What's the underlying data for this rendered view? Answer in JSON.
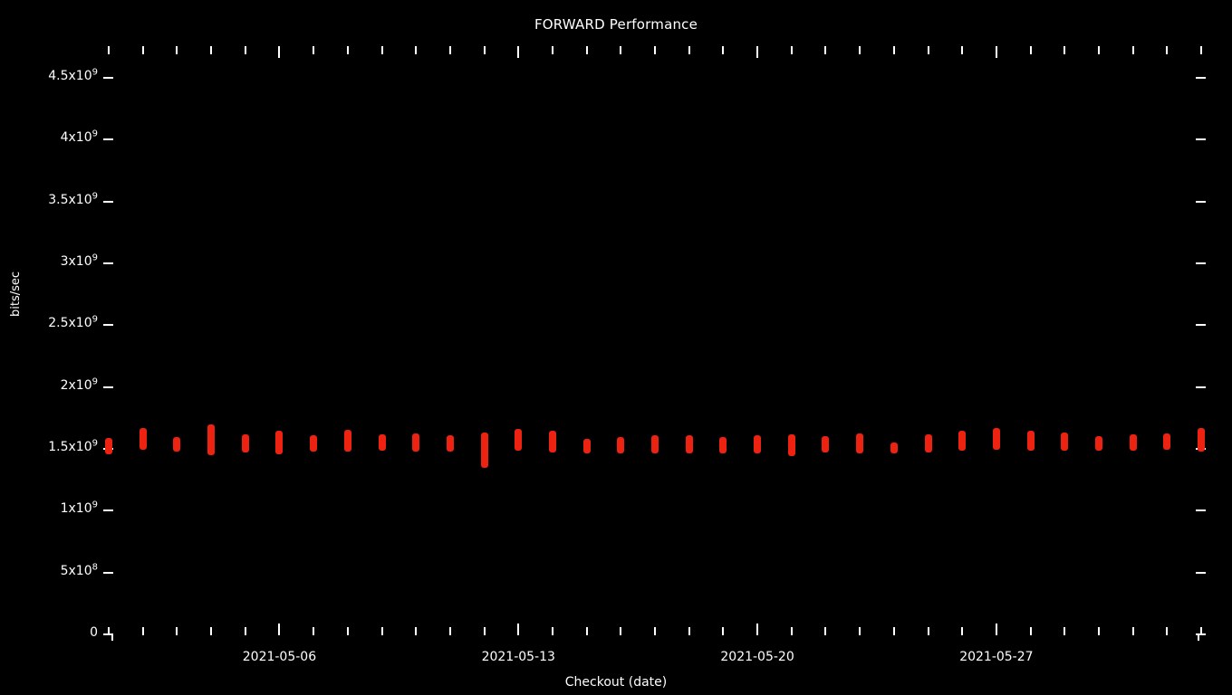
{
  "chart_data": {
    "type": "scatter",
    "title": "FORWARD Performance",
    "xlabel": "Checkout (date)",
    "ylabel": "bits/sec",
    "grid": false,
    "legend": null,
    "point_color": "#ee2211",
    "background": "#000000",
    "foreground": "#ffffff",
    "ylim": [
      0,
      4750000000
    ],
    "y_ticks": [
      {
        "value": 0,
        "label": "0"
      },
      {
        "value": 500000000,
        "label": "5x10",
        "exp": "8"
      },
      {
        "value": 1000000000,
        "label": "1x10",
        "exp": "9"
      },
      {
        "value": 1500000000,
        "label": "1.5x10",
        "exp": "9"
      },
      {
        "value": 2000000000,
        "label": "2x10",
        "exp": "9"
      },
      {
        "value": 2500000000,
        "label": "2.5x10",
        "exp": "9"
      },
      {
        "value": 3000000000,
        "label": "3x10",
        "exp": "9"
      },
      {
        "value": 3500000000,
        "label": "3.5x10",
        "exp": "9"
      },
      {
        "value": 4000000000,
        "label": "4x10",
        "exp": "9"
      },
      {
        "value": 4500000000,
        "label": "4.5x10",
        "exp": "9"
      }
    ],
    "x_tick_labels": [
      {
        "label": "2021-05-06",
        "index": 5
      },
      {
        "label": "2021-05-13",
        "index": 12
      },
      {
        "label": "2021-05-20",
        "index": 19
      },
      {
        "label": "2021-05-27",
        "index": 26
      }
    ],
    "x_major_indices": [
      5,
      12,
      19,
      26
    ],
    "x_tick_count": 33,
    "x": [
      "2021-05-01",
      "2021-05-02",
      "2021-05-03",
      "2021-05-04",
      "2021-05-05",
      "2021-05-06",
      "2021-05-07",
      "2021-05-08",
      "2021-05-09",
      "2021-05-10",
      "2021-05-11",
      "2021-05-12",
      "2021-05-13",
      "2021-05-14",
      "2021-05-15",
      "2021-05-16",
      "2021-05-17",
      "2021-05-18",
      "2021-05-19",
      "2021-05-20",
      "2021-05-21",
      "2021-05-22",
      "2021-05-23",
      "2021-05-24",
      "2021-05-25",
      "2021-05-26",
      "2021-05-27",
      "2021-05-28",
      "2021-05-29",
      "2021-05-30",
      "2021-05-31",
      "2021-06-01",
      "2021-06-02"
    ],
    "values": [
      1520000000,
      1580000000,
      1540000000,
      1570000000,
      1545000000,
      1555000000,
      1545000000,
      1565000000,
      1550000000,
      1550000000,
      1545000000,
      1500000000,
      1570000000,
      1560000000,
      1520000000,
      1530000000,
      1540000000,
      1540000000,
      1530000000,
      1540000000,
      1530000000,
      1535000000,
      1545000000,
      1510000000,
      1545000000,
      1565000000,
      1580000000,
      1565000000,
      1560000000,
      1545000000,
      1555000000,
      1560000000,
      1570000000
    ],
    "spread": [
      18,
      24,
      16,
      34,
      20,
      26,
      18,
      24,
      18,
      20,
      18,
      34,
      24,
      24,
      16,
      18,
      20,
      20,
      18,
      20,
      24,
      18,
      22,
      12,
      20,
      22,
      24,
      22,
      20,
      16,
      18,
      18,
      26
    ],
    "series_name": "FORWARD",
    "notes": "Red vertical point clusters near 1.5x10^9 bits/sec across May 2021 checkouts"
  }
}
